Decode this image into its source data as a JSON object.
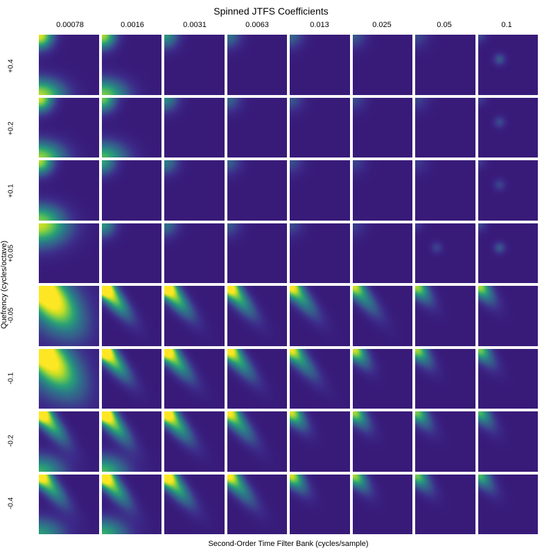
{
  "chart_data": {
    "type": "heatmap",
    "title": "Spinned JTFS Coefficients",
    "xlabel": "Second-Order Time Filter Bank (cycles/sample)",
    "ylabel": "Quefrency (cycles/octave)",
    "col_values": [
      "0.00078",
      "0.0016",
      "0.0031",
      "0.0063",
      "0.013",
      "0.025",
      "0.05",
      "0.1"
    ],
    "row_values": [
      "+0.4",
      "+0.2",
      "+0.1",
      "+0.05",
      "-0.05",
      "-0.1",
      "-0.2",
      "-0.4"
    ],
    "colormap": "viridis",
    "grid_rows": 8,
    "grid_cols": 8,
    "notes": "8x8 grid of 2D heatmap subplots. Top 4 rows (positive quefrency) show weak activation mostly in top-left corners and some bottom-left edge glow in first columns; activation decreases left-to-right. Bottom 4 rows (negative quefrency) show strong diagonal streaks from top-left toward center, decreasing in width/intensity as column index increases.",
    "subplots": [
      {
        "row": 0,
        "col": 0,
        "pattern": "corner_tl_bl",
        "intensity": 0.9
      },
      {
        "row": 0,
        "col": 1,
        "pattern": "corner_tl_bl",
        "intensity": 0.8
      },
      {
        "row": 0,
        "col": 2,
        "pattern": "corner_tl",
        "intensity": 0.5
      },
      {
        "row": 0,
        "col": 3,
        "pattern": "corner_tl",
        "intensity": 0.35
      },
      {
        "row": 0,
        "col": 4,
        "pattern": "corner_tl",
        "intensity": 0.3
      },
      {
        "row": 0,
        "col": 5,
        "pattern": "corner_tl",
        "intensity": 0.25
      },
      {
        "row": 0,
        "col": 6,
        "pattern": "corner_tl",
        "intensity": 0.2
      },
      {
        "row": 0,
        "col": 7,
        "pattern": "dot_center",
        "intensity": 0.25
      },
      {
        "row": 1,
        "col": 0,
        "pattern": "corner_tl_bl",
        "intensity": 0.85
      },
      {
        "row": 1,
        "col": 1,
        "pattern": "corner_tl_bl",
        "intensity": 0.7
      },
      {
        "row": 1,
        "col": 2,
        "pattern": "corner_tl",
        "intensity": 0.45
      },
      {
        "row": 1,
        "col": 3,
        "pattern": "corner_tl",
        "intensity": 0.3
      },
      {
        "row": 1,
        "col": 4,
        "pattern": "corner_tl",
        "intensity": 0.25
      },
      {
        "row": 1,
        "col": 5,
        "pattern": "corner_tl",
        "intensity": 0.2
      },
      {
        "row": 1,
        "col": 6,
        "pattern": "corner_tl",
        "intensity": 0.18
      },
      {
        "row": 1,
        "col": 7,
        "pattern": "dot_center",
        "intensity": 0.2
      },
      {
        "row": 2,
        "col": 0,
        "pattern": "corner_tl_bl",
        "intensity": 0.8
      },
      {
        "row": 2,
        "col": 1,
        "pattern": "corner_tl",
        "intensity": 0.55
      },
      {
        "row": 2,
        "col": 2,
        "pattern": "corner_tl",
        "intensity": 0.4
      },
      {
        "row": 2,
        "col": 3,
        "pattern": "corner_tl",
        "intensity": 0.28
      },
      {
        "row": 2,
        "col": 4,
        "pattern": "corner_tl",
        "intensity": 0.22
      },
      {
        "row": 2,
        "col": 5,
        "pattern": "corner_tl",
        "intensity": 0.18
      },
      {
        "row": 2,
        "col": 6,
        "pattern": "corner_tl",
        "intensity": 0.15
      },
      {
        "row": 2,
        "col": 7,
        "pattern": "dot_center",
        "intensity": 0.18
      },
      {
        "row": 3,
        "col": 0,
        "pattern": "corner_tl_wide",
        "intensity": 0.85
      },
      {
        "row": 3,
        "col": 1,
        "pattern": "corner_tl",
        "intensity": 0.5
      },
      {
        "row": 3,
        "col": 2,
        "pattern": "corner_tl",
        "intensity": 0.35
      },
      {
        "row": 3,
        "col": 3,
        "pattern": "corner_tl",
        "intensity": 0.25
      },
      {
        "row": 3,
        "col": 4,
        "pattern": "corner_tl",
        "intensity": 0.2
      },
      {
        "row": 3,
        "col": 5,
        "pattern": "corner_tl",
        "intensity": 0.16
      },
      {
        "row": 3,
        "col": 6,
        "pattern": "dot_center",
        "intensity": 0.18
      },
      {
        "row": 3,
        "col": 7,
        "pattern": "dot_center",
        "intensity": 0.25
      },
      {
        "row": 4,
        "col": 0,
        "pattern": "diag_wide",
        "intensity": 1.0
      },
      {
        "row": 4,
        "col": 1,
        "pattern": "diag",
        "intensity": 0.95
      },
      {
        "row": 4,
        "col": 2,
        "pattern": "diag",
        "intensity": 0.85
      },
      {
        "row": 4,
        "col": 3,
        "pattern": "diag",
        "intensity": 0.75
      },
      {
        "row": 4,
        "col": 4,
        "pattern": "diag",
        "intensity": 0.65
      },
      {
        "row": 4,
        "col": 5,
        "pattern": "diag",
        "intensity": 0.55
      },
      {
        "row": 4,
        "col": 6,
        "pattern": "diag_short",
        "intensity": 0.5
      },
      {
        "row": 4,
        "col": 7,
        "pattern": "diag_short",
        "intensity": 0.5
      },
      {
        "row": 5,
        "col": 0,
        "pattern": "diag_wide",
        "intensity": 0.95
      },
      {
        "row": 5,
        "col": 1,
        "pattern": "diag",
        "intensity": 0.9
      },
      {
        "row": 5,
        "col": 2,
        "pattern": "diag",
        "intensity": 0.8
      },
      {
        "row": 5,
        "col": 3,
        "pattern": "diag",
        "intensity": 0.7
      },
      {
        "row": 5,
        "col": 4,
        "pattern": "diag",
        "intensity": 0.6
      },
      {
        "row": 5,
        "col": 5,
        "pattern": "diag_short",
        "intensity": 0.55
      },
      {
        "row": 5,
        "col": 6,
        "pattern": "diag_short",
        "intensity": 0.5
      },
      {
        "row": 5,
        "col": 7,
        "pattern": "diag_short",
        "intensity": 0.45
      },
      {
        "row": 6,
        "col": 0,
        "pattern": "diag_bl",
        "intensity": 0.85
      },
      {
        "row": 6,
        "col": 1,
        "pattern": "diag_bl",
        "intensity": 0.9
      },
      {
        "row": 6,
        "col": 2,
        "pattern": "diag",
        "intensity": 0.8
      },
      {
        "row": 6,
        "col": 3,
        "pattern": "diag",
        "intensity": 0.65
      },
      {
        "row": 6,
        "col": 4,
        "pattern": "diag_short",
        "intensity": 0.55
      },
      {
        "row": 6,
        "col": 5,
        "pattern": "diag_short",
        "intensity": 0.5
      },
      {
        "row": 6,
        "col": 6,
        "pattern": "diag_short",
        "intensity": 0.45
      },
      {
        "row": 6,
        "col": 7,
        "pattern": "diag_short",
        "intensity": 0.4
      },
      {
        "row": 7,
        "col": 0,
        "pattern": "diag_bl",
        "intensity": 0.75
      },
      {
        "row": 7,
        "col": 1,
        "pattern": "diag_bl",
        "intensity": 0.85
      },
      {
        "row": 7,
        "col": 2,
        "pattern": "diag",
        "intensity": 0.8
      },
      {
        "row": 7,
        "col": 3,
        "pattern": "diag",
        "intensity": 0.65
      },
      {
        "row": 7,
        "col": 4,
        "pattern": "diag_short",
        "intensity": 0.55
      },
      {
        "row": 7,
        "col": 5,
        "pattern": "diag_short",
        "intensity": 0.5
      },
      {
        "row": 7,
        "col": 6,
        "pattern": "diag_short",
        "intensity": 0.45
      },
      {
        "row": 7,
        "col": 7,
        "pattern": "diag_short",
        "intensity": 0.4
      }
    ]
  }
}
